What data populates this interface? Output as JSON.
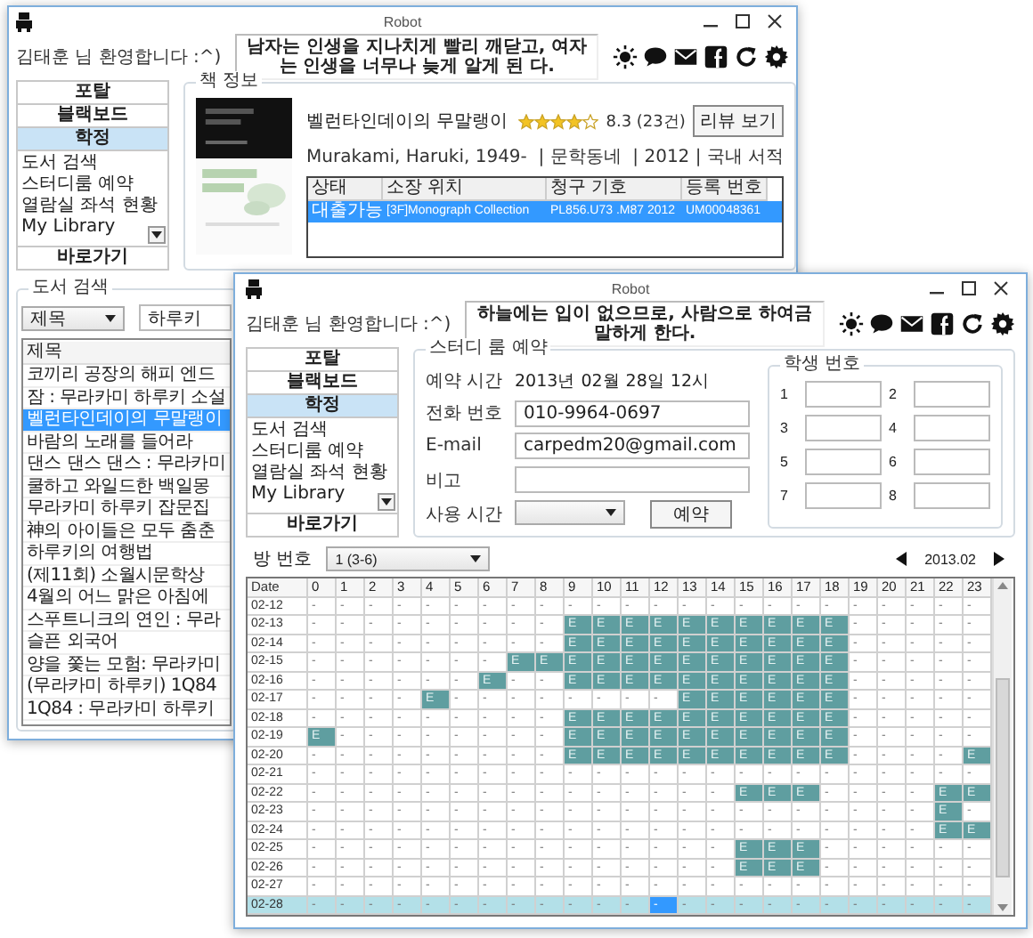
{
  "windows": [
    {
      "kind": "library",
      "title": "Robot",
      "welcome": "김태훈 님 환영합니다 :^)",
      "quote": "남자는 인생을 지나치게 빨리 깨닫고, 여자는 인생을 너무나 늦게 알게 된 다.",
      "nav": {
        "buttons": [
          {
            "label": "포탈",
            "selected": false
          },
          {
            "label": "블랙보드",
            "selected": false
          },
          {
            "label": "학정",
            "selected": true
          }
        ],
        "items": [
          "도서 검색",
          "스터디룸 예약",
          "열람실 좌석 현황",
          "My Library"
        ],
        "shortcut": "바로가기"
      },
      "book_info": {
        "legend": "책 정보",
        "title": "벨런타인데이의 무말랭이",
        "stars": 4,
        "rating": "8.3 (23건)",
        "review_button": "리뷰 보기",
        "meta": "Murakami, Haruki, 1949-  | 문학동네  | 2012 | 국내 서적",
        "table": {
          "columns": [
            "상태",
            "소장 위치",
            "청구 기호",
            "등록 번호"
          ],
          "rows": [
            {
              "cells": [
                "대출가능",
                "[3F]Monograph Collection",
                "PL856.U73 .M87 2012",
                "UM00048361"
              ],
              "selected": true
            }
          ]
        }
      },
      "search": {
        "legend": "도서 검색",
        "field": "제목",
        "query": "하루키",
        "list_header": "제목",
        "results": [
          {
            "title": "코끼리 공장의 해피 엔드",
            "selected": false
          },
          {
            "title": "잠 : 무라카미 하루키 소설",
            "selected": false
          },
          {
            "title": "벨런타인데이의 무말랭이",
            "selected": true
          },
          {
            "title": "바람의 노래를 들어라",
            "selected": false
          },
          {
            "title": "댄스 댄스 댄스 : 무라카미",
            "selected": false
          },
          {
            "title": "쿨하고 와일드한 백일몽",
            "selected": false
          },
          {
            "title": "무라카미 하루키 잡문집",
            "selected": false
          },
          {
            "title": "神의 아이들은 모두 춤춘",
            "selected": false
          },
          {
            "title": "하루키의 여행법",
            "selected": false
          },
          {
            "title": "(제11회) 소월시문학상",
            "selected": false
          },
          {
            "title": "4월의 어느 맑은 아침에",
            "selected": false
          },
          {
            "title": "스푸트니크의 연인 : 무라",
            "selected": false
          },
          {
            "title": "슬픈 외국어",
            "selected": false
          },
          {
            "title": "양을 쫓는 모험: 무라카미",
            "selected": false
          },
          {
            "title": "(무라카미 하루키) 1Q84",
            "selected": false
          },
          {
            "title": "1Q84 : 무라카미 하루키",
            "selected": false
          }
        ]
      }
    },
    {
      "kind": "study_room",
      "title": "Robot",
      "welcome": "김태훈 님 환영합니다 :^)",
      "quote": "하늘에는 입이 없으므로, 사람으로 하여금 말하게 한다.",
      "nav": {
        "buttons": [
          {
            "label": "포탈",
            "selected": false
          },
          {
            "label": "블랙보드",
            "selected": false
          },
          {
            "label": "학정",
            "selected": true
          }
        ],
        "items": [
          "도서 검색",
          "스터디룸 예약",
          "열람실 좌석 현황",
          "My Library"
        ],
        "shortcut": "바로가기"
      },
      "reservation": {
        "legend": "스터디 룸 예약",
        "fields": [
          {
            "kind": "text",
            "label": "예약 시간",
            "value": "2013년 02월 28일 12시"
          },
          {
            "kind": "input",
            "label": "전화 번호",
            "value": "010-9964-0697"
          },
          {
            "kind": "input",
            "label": "E-mail",
            "value": "carpedm20@gmail.com"
          },
          {
            "kind": "input",
            "label": "비고"
          },
          {
            "kind": "select",
            "label": "사용 시간"
          }
        ],
        "reserve_button": "예약",
        "students": {
          "legend": "학생 번호",
          "slots": [
            "1",
            "2",
            "3",
            "4",
            "5",
            "6",
            "7",
            "8"
          ]
        }
      },
      "schedule": {
        "room_label": "방 번호",
        "room": "1 (3-6)",
        "month": "2013.02",
        "date_header": "Date",
        "hours": [
          "0",
          "1",
          "2",
          "3",
          "4",
          "5",
          "6",
          "7",
          "8",
          "9",
          "10",
          "11",
          "12",
          "13",
          "14",
          "15",
          "16",
          "17",
          "18",
          "19",
          "20",
          "21",
          "22",
          "23"
        ],
        "rows": [
          {
            "date": "02-12",
            "selected": false,
            "cells": [
              "-",
              "-",
              "-",
              "-",
              "-",
              "-",
              "-",
              "-",
              "-",
              "-",
              "-",
              "-",
              "-",
              "-",
              "-",
              "-",
              "-",
              "-",
              "-",
              "-",
              "-",
              "-",
              "-",
              "-"
            ],
            "booked": [
              false,
              false,
              false,
              false,
              false,
              false,
              false,
              false,
              false,
              false,
              false,
              false,
              false,
              false,
              false,
              false,
              false,
              false,
              false,
              false,
              false,
              false,
              false,
              false
            ],
            "focused": [
              false,
              false,
              false,
              false,
              false,
              false,
              false,
              false,
              false,
              false,
              false,
              false,
              false,
              false,
              false,
              false,
              false,
              false,
              false,
              false,
              false,
              false,
              false,
              false
            ]
          },
          {
            "date": "02-13",
            "selected": false,
            "cells": [
              "-",
              "-",
              "-",
              "-",
              "-",
              "-",
              "-",
              "-",
              "-",
              "E",
              "E",
              "E",
              "E",
              "E",
              "E",
              "E",
              "E",
              "E",
              "E",
              "-",
              "-",
              "-",
              "-",
              "-"
            ],
            "booked": [
              false,
              false,
              false,
              false,
              false,
              false,
              false,
              false,
              false,
              true,
              true,
              true,
              true,
              true,
              true,
              true,
              true,
              true,
              true,
              false,
              false,
              false,
              false,
              false
            ],
            "focused": [
              false,
              false,
              false,
              false,
              false,
              false,
              false,
              false,
              false,
              false,
              false,
              false,
              false,
              false,
              false,
              false,
              false,
              false,
              false,
              false,
              false,
              false,
              false,
              false
            ]
          },
          {
            "date": "02-14",
            "selected": false,
            "cells": [
              "-",
              "-",
              "-",
              "-",
              "-",
              "-",
              "-",
              "-",
              "-",
              "E",
              "E",
              "E",
              "E",
              "E",
              "E",
              "E",
              "E",
              "E",
              "E",
              "-",
              "-",
              "-",
              "-",
              "-"
            ],
            "booked": [
              false,
              false,
              false,
              false,
              false,
              false,
              false,
              false,
              false,
              true,
              true,
              true,
              true,
              true,
              true,
              true,
              true,
              true,
              true,
              false,
              false,
              false,
              false,
              false
            ],
            "focused": [
              false,
              false,
              false,
              false,
              false,
              false,
              false,
              false,
              false,
              false,
              false,
              false,
              false,
              false,
              false,
              false,
              false,
              false,
              false,
              false,
              false,
              false,
              false,
              false
            ]
          },
          {
            "date": "02-15",
            "selected": false,
            "cells": [
              "-",
              "-",
              "-",
              "-",
              "-",
              "-",
              "-",
              "E",
              "E",
              "E",
              "E",
              "E",
              "E",
              "E",
              "E",
              "E",
              "E",
              "E",
              "E",
              "-",
              "-",
              "-",
              "-",
              "-"
            ],
            "booked": [
              false,
              false,
              false,
              false,
              false,
              false,
              false,
              true,
              true,
              true,
              true,
              true,
              true,
              true,
              true,
              true,
              true,
              true,
              true,
              false,
              false,
              false,
              false,
              false
            ],
            "focused": [
              false,
              false,
              false,
              false,
              false,
              false,
              false,
              false,
              false,
              false,
              false,
              false,
              false,
              false,
              false,
              false,
              false,
              false,
              false,
              false,
              false,
              false,
              false,
              false
            ]
          },
          {
            "date": "02-16",
            "selected": false,
            "cells": [
              "-",
              "-",
              "-",
              "-",
              "-",
              "-",
              "E",
              "-",
              "-",
              "E",
              "E",
              "E",
              "E",
              "E",
              "E",
              "E",
              "E",
              "E",
              "E",
              "-",
              "-",
              "-",
              "-",
              "-"
            ],
            "booked": [
              false,
              false,
              false,
              false,
              false,
              false,
              true,
              false,
              false,
              true,
              true,
              true,
              true,
              true,
              true,
              true,
              true,
              true,
              true,
              false,
              false,
              false,
              false,
              false
            ],
            "focused": [
              false,
              false,
              false,
              false,
              false,
              false,
              false,
              false,
              false,
              false,
              false,
              false,
              false,
              false,
              false,
              false,
              false,
              false,
              false,
              false,
              false,
              false,
              false,
              false
            ]
          },
          {
            "date": "02-17",
            "selected": false,
            "cells": [
              "-",
              "-",
              "-",
              "-",
              "E",
              "-",
              "-",
              "-",
              "-",
              "-",
              "-",
              "-",
              "-",
              "E",
              "E",
              "E",
              "E",
              "E",
              "E",
              "-",
              "-",
              "-",
              "-",
              "-"
            ],
            "booked": [
              false,
              false,
              false,
              false,
              true,
              false,
              false,
              false,
              false,
              false,
              false,
              false,
              false,
              true,
              true,
              true,
              true,
              true,
              true,
              false,
              false,
              false,
              false,
              false
            ],
            "focused": [
              false,
              false,
              false,
              false,
              false,
              false,
              false,
              false,
              false,
              false,
              false,
              false,
              false,
              false,
              false,
              false,
              false,
              false,
              false,
              false,
              false,
              false,
              false,
              false
            ]
          },
          {
            "date": "02-18",
            "selected": false,
            "cells": [
              "-",
              "-",
              "-",
              "-",
              "-",
              "-",
              "-",
              "-",
              "-",
              "E",
              "E",
              "E",
              "E",
              "E",
              "E",
              "E",
              "E",
              "E",
              "E",
              "-",
              "-",
              "-",
              "-",
              "-"
            ],
            "booked": [
              false,
              false,
              false,
              false,
              false,
              false,
              false,
              false,
              false,
              true,
              true,
              true,
              true,
              true,
              true,
              true,
              true,
              true,
              true,
              false,
              false,
              false,
              false,
              false
            ],
            "focused": [
              false,
              false,
              false,
              false,
              false,
              false,
              false,
              false,
              false,
              false,
              false,
              false,
              false,
              false,
              false,
              false,
              false,
              false,
              false,
              false,
              false,
              false,
              false,
              false
            ]
          },
          {
            "date": "02-19",
            "selected": false,
            "cells": [
              "E",
              "-",
              "-",
              "-",
              "-",
              "-",
              "-",
              "-",
              "-",
              "E",
              "E",
              "E",
              "E",
              "E",
              "E",
              "E",
              "E",
              "E",
              "E",
              "-",
              "-",
              "-",
              "-",
              "-"
            ],
            "booked": [
              true,
              false,
              false,
              false,
              false,
              false,
              false,
              false,
              false,
              true,
              true,
              true,
              true,
              true,
              true,
              true,
              true,
              true,
              true,
              false,
              false,
              false,
              false,
              false
            ],
            "focused": [
              false,
              false,
              false,
              false,
              false,
              false,
              false,
              false,
              false,
              false,
              false,
              false,
              false,
              false,
              false,
              false,
              false,
              false,
              false,
              false,
              false,
              false,
              false,
              false
            ]
          },
          {
            "date": "02-20",
            "selected": false,
            "cells": [
              "-",
              "-",
              "-",
              "-",
              "-",
              "-",
              "-",
              "-",
              "-",
              "E",
              "E",
              "E",
              "E",
              "E",
              "E",
              "E",
              "E",
              "E",
              "E",
              "-",
              "-",
              "-",
              "-",
              "E"
            ],
            "booked": [
              false,
              false,
              false,
              false,
              false,
              false,
              false,
              false,
              false,
              true,
              true,
              true,
              true,
              true,
              true,
              true,
              true,
              true,
              true,
              false,
              false,
              false,
              false,
              true
            ],
            "focused": [
              false,
              false,
              false,
              false,
              false,
              false,
              false,
              false,
              false,
              false,
              false,
              false,
              false,
              false,
              false,
              false,
              false,
              false,
              false,
              false,
              false,
              false,
              false,
              false
            ]
          },
          {
            "date": "02-21",
            "selected": false,
            "cells": [
              "-",
              "-",
              "-",
              "-",
              "-",
              "-",
              "-",
              "-",
              "-",
              "-",
              "-",
              "-",
              "-",
              "-",
              "-",
              "-",
              "-",
              "-",
              "-",
              "-",
              "-",
              "-",
              "-",
              "-"
            ],
            "booked": [
              false,
              false,
              false,
              false,
              false,
              false,
              false,
              false,
              false,
              false,
              false,
              false,
              false,
              false,
              false,
              false,
              false,
              false,
              false,
              false,
              false,
              false,
              false,
              false
            ],
            "focused": [
              false,
              false,
              false,
              false,
              false,
              false,
              false,
              false,
              false,
              false,
              false,
              false,
              false,
              false,
              false,
              false,
              false,
              false,
              false,
              false,
              false,
              false,
              false,
              false
            ]
          },
          {
            "date": "02-22",
            "selected": false,
            "cells": [
              "-",
              "-",
              "-",
              "-",
              "-",
              "-",
              "-",
              "-",
              "-",
              "-",
              "-",
              "-",
              "-",
              "-",
              "-",
              "E",
              "E",
              "E",
              "-",
              "-",
              "-",
              "-",
              "E",
              "E"
            ],
            "booked": [
              false,
              false,
              false,
              false,
              false,
              false,
              false,
              false,
              false,
              false,
              false,
              false,
              false,
              false,
              false,
              true,
              true,
              true,
              false,
              false,
              false,
              false,
              true,
              true
            ],
            "focused": [
              false,
              false,
              false,
              false,
              false,
              false,
              false,
              false,
              false,
              false,
              false,
              false,
              false,
              false,
              false,
              false,
              false,
              false,
              false,
              false,
              false,
              false,
              false,
              false
            ]
          },
          {
            "date": "02-23",
            "selected": false,
            "cells": [
              "-",
              "-",
              "-",
              "-",
              "-",
              "-",
              "-",
              "-",
              "-",
              "-",
              "-",
              "-",
              "-",
              "-",
              "-",
              "-",
              "-",
              "-",
              "-",
              "-",
              "-",
              "-",
              "E",
              "-"
            ],
            "booked": [
              false,
              false,
              false,
              false,
              false,
              false,
              false,
              false,
              false,
              false,
              false,
              false,
              false,
              false,
              false,
              false,
              false,
              false,
              false,
              false,
              false,
              false,
              true,
              false
            ],
            "focused": [
              false,
              false,
              false,
              false,
              false,
              false,
              false,
              false,
              false,
              false,
              false,
              false,
              false,
              false,
              false,
              false,
              false,
              false,
              false,
              false,
              false,
              false,
              false,
              false
            ]
          },
          {
            "date": "02-24",
            "selected": false,
            "cells": [
              "-",
              "-",
              "-",
              "-",
              "-",
              "-",
              "-",
              "-",
              "-",
              "-",
              "-",
              "-",
              "-",
              "-",
              "-",
              "-",
              "-",
              "-",
              "-",
              "-",
              "-",
              "-",
              "E",
              "E"
            ],
            "booked": [
              false,
              false,
              false,
              false,
              false,
              false,
              false,
              false,
              false,
              false,
              false,
              false,
              false,
              false,
              false,
              false,
              false,
              false,
              false,
              false,
              false,
              false,
              true,
              true
            ],
            "focused": [
              false,
              false,
              false,
              false,
              false,
              false,
              false,
              false,
              false,
              false,
              false,
              false,
              false,
              false,
              false,
              false,
              false,
              false,
              false,
              false,
              false,
              false,
              false,
              false
            ]
          },
          {
            "date": "02-25",
            "selected": false,
            "cells": [
              "-",
              "-",
              "-",
              "-",
              "-",
              "-",
              "-",
              "-",
              "-",
              "-",
              "-",
              "-",
              "-",
              "-",
              "-",
              "E",
              "E",
              "E",
              "-",
              "-",
              "-",
              "-",
              "-",
              "-"
            ],
            "booked": [
              false,
              false,
              false,
              false,
              false,
              false,
              false,
              false,
              false,
              false,
              false,
              false,
              false,
              false,
              false,
              true,
              true,
              true,
              false,
              false,
              false,
              false,
              false,
              false
            ],
            "focused": [
              false,
              false,
              false,
              false,
              false,
              false,
              false,
              false,
              false,
              false,
              false,
              false,
              false,
              false,
              false,
              false,
              false,
              false,
              false,
              false,
              false,
              false,
              false,
              false
            ]
          },
          {
            "date": "02-26",
            "selected": false,
            "cells": [
              "-",
              "-",
              "-",
              "-",
              "-",
              "-",
              "-",
              "-",
              "-",
              "-",
              "-",
              "-",
              "-",
              "-",
              "-",
              "E",
              "E",
              "E",
              "-",
              "-",
              "-",
              "-",
              "-",
              "-"
            ],
            "booked": [
              false,
              false,
              false,
              false,
              false,
              false,
              false,
              false,
              false,
              false,
              false,
              false,
              false,
              false,
              false,
              true,
              true,
              true,
              false,
              false,
              false,
              false,
              false,
              false
            ],
            "focused": [
              false,
              false,
              false,
              false,
              false,
              false,
              false,
              false,
              false,
              false,
              false,
              false,
              false,
              false,
              false,
              false,
              false,
              false,
              false,
              false,
              false,
              false,
              false,
              false
            ]
          },
          {
            "date": "02-27",
            "selected": false,
            "cells": [
              "-",
              "-",
              "-",
              "-",
              "-",
              "-",
              "-",
              "-",
              "-",
              "-",
              "-",
              "-",
              "-",
              "-",
              "-",
              "-",
              "-",
              "-",
              "-",
              "-",
              "-",
              "-",
              "-",
              "-"
            ],
            "booked": [
              false,
              false,
              false,
              false,
              false,
              false,
              false,
              false,
              false,
              false,
              false,
              false,
              false,
              false,
              false,
              false,
              false,
              false,
              false,
              false,
              false,
              false,
              false,
              false
            ],
            "focused": [
              false,
              false,
              false,
              false,
              false,
              false,
              false,
              false,
              false,
              false,
              false,
              false,
              false,
              false,
              false,
              false,
              false,
              false,
              false,
              false,
              false,
              false,
              false,
              false
            ]
          },
          {
            "date": "02-28",
            "selected": true,
            "cells": [
              "-",
              "-",
              "-",
              "-",
              "-",
              "-",
              "-",
              "-",
              "-",
              "-",
              "-",
              "-",
              "-",
              "-",
              "-",
              "-",
              "-",
              "-",
              "-",
              "-",
              "-",
              "-",
              "-",
              "-"
            ],
            "booked": [
              false,
              false,
              false,
              false,
              false,
              false,
              false,
              false,
              false,
              false,
              false,
              false,
              false,
              false,
              false,
              false,
              false,
              false,
              false,
              false,
              false,
              false,
              false,
              false
            ],
            "focused": [
              false,
              false,
              false,
              false,
              false,
              false,
              false,
              false,
              false,
              false,
              false,
              false,
              true,
              false,
              false,
              false,
              false,
              false,
              false,
              false,
              false,
              false,
              false,
              false
            ]
          }
        ]
      }
    }
  ]
}
